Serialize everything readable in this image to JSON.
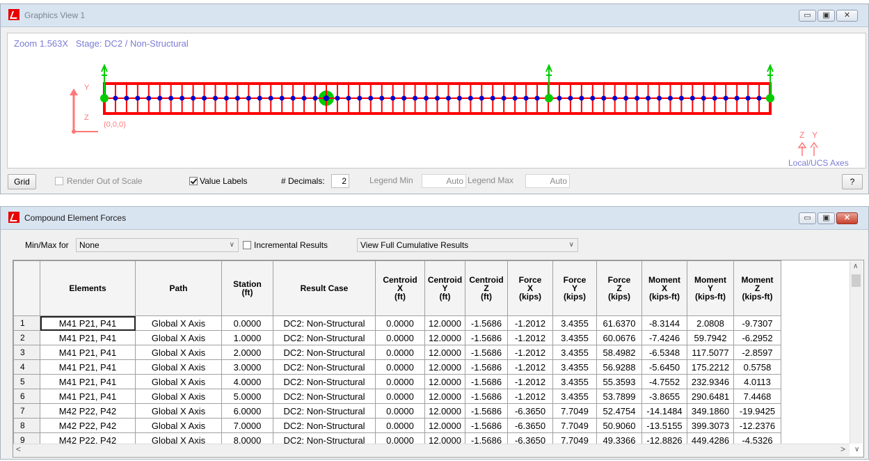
{
  "graphics": {
    "title": "Graphics View 1",
    "zoom_label": "Zoom",
    "zoom_value": "1.563X",
    "stage_label": "Stage:",
    "stage_value": "DC2 / Non-Structural",
    "axis_y": "Y",
    "axis_z": "Z",
    "origin_label": "(0,0,0)",
    "local_axes_label": "Local/UCS Axes",
    "local_z": "Z",
    "local_y": "Y",
    "toolbar": {
      "grid_label": "Grid",
      "render_out_of_scale_label": "Render Out of Scale",
      "render_out_of_scale_checked": false,
      "value_labels_label": "Value Labels",
      "value_labels_checked": true,
      "decimals_label": "# Decimals:",
      "decimals_value": "2",
      "legend_min_label": "Legend Min",
      "legend_min_value": "Auto",
      "legend_max_label": "Legend Max",
      "legend_max_value": "Auto",
      "help_label": "?"
    },
    "colors": {
      "element": "#ff0000",
      "node": "#0000cc",
      "support": "#00cc00",
      "axes": "#ff8888"
    }
  },
  "forces": {
    "title": "Compound Element Forces",
    "minmax_label": "Min/Max for",
    "minmax_value": "None",
    "incremental_label": "Incremental Results",
    "incremental_checked": false,
    "view_value": "View Full Cumulative Results",
    "columns": [
      {
        "lines": [
          "Elements"
        ]
      },
      {
        "lines": [
          "Path"
        ]
      },
      {
        "lines": [
          "Station",
          "(ft)"
        ]
      },
      {
        "lines": [
          "Result Case"
        ]
      },
      {
        "lines": [
          "Centroid",
          "X",
          "(ft)"
        ]
      },
      {
        "lines": [
          "Centroid",
          "Y",
          "(ft)"
        ]
      },
      {
        "lines": [
          "Centroid",
          "Z",
          "(ft)"
        ]
      },
      {
        "lines": [
          "Force",
          "X",
          "(kips)"
        ]
      },
      {
        "lines": [
          "Force",
          "Y",
          "(kips)"
        ]
      },
      {
        "lines": [
          "Force",
          "Z",
          "(kips)"
        ]
      },
      {
        "lines": [
          "Moment",
          "X",
          "(kips-ft)"
        ]
      },
      {
        "lines": [
          "Moment",
          "Y",
          "(kips-ft)"
        ]
      },
      {
        "lines": [
          "Moment",
          "Z",
          "(kips-ft)"
        ]
      }
    ],
    "rows": [
      [
        "1",
        "M41  P21, P41",
        "Global X Axis",
        "0.0000",
        "DC2: Non-Structural",
        "0.0000",
        "12.0000",
        "-1.5686",
        "-1.2012",
        "3.4355",
        "61.6370",
        "-8.3144",
        "2.0808",
        "-9.7307"
      ],
      [
        "2",
        "M41  P21, P41",
        "Global X Axis",
        "1.0000",
        "DC2: Non-Structural",
        "0.0000",
        "12.0000",
        "-1.5686",
        "-1.2012",
        "3.4355",
        "60.0676",
        "-7.4246",
        "59.7942",
        "-6.2952"
      ],
      [
        "3",
        "M41  P21, P41",
        "Global X Axis",
        "2.0000",
        "DC2: Non-Structural",
        "0.0000",
        "12.0000",
        "-1.5686",
        "-1.2012",
        "3.4355",
        "58.4982",
        "-6.5348",
        "117.5077",
        "-2.8597"
      ],
      [
        "4",
        "M41  P21, P41",
        "Global X Axis",
        "3.0000",
        "DC2: Non-Structural",
        "0.0000",
        "12.0000",
        "-1.5686",
        "-1.2012",
        "3.4355",
        "56.9288",
        "-5.6450",
        "175.2212",
        "0.5758"
      ],
      [
        "5",
        "M41  P21, P41",
        "Global X Axis",
        "4.0000",
        "DC2: Non-Structural",
        "0.0000",
        "12.0000",
        "-1.5686",
        "-1.2012",
        "3.4355",
        "55.3593",
        "-4.7552",
        "232.9346",
        "4.0113"
      ],
      [
        "6",
        "M41  P21, P41",
        "Global X Axis",
        "5.0000",
        "DC2: Non-Structural",
        "0.0000",
        "12.0000",
        "-1.5686",
        "-1.2012",
        "3.4355",
        "53.7899",
        "-3.8655",
        "290.6481",
        "7.4468"
      ],
      [
        "7",
        "M42  P22, P42",
        "Global X Axis",
        "6.0000",
        "DC2: Non-Structural",
        "0.0000",
        "12.0000",
        "-1.5686",
        "-6.3650",
        "7.7049",
        "52.4754",
        "-14.1484",
        "349.1860",
        "-19.9425"
      ],
      [
        "8",
        "M42  P22, P42",
        "Global X Axis",
        "7.0000",
        "DC2: Non-Structural",
        "0.0000",
        "12.0000",
        "-1.5686",
        "-6.3650",
        "7.7049",
        "50.9060",
        "-13.5155",
        "399.3073",
        "-12.2376"
      ],
      [
        "9",
        "M42  P22, P42",
        "Global X Axis",
        "8.0000",
        "DC2: Non-Structural",
        "0.0000",
        "12.0000",
        "-1.5686",
        "-6.3650",
        "7.7049",
        "49.3366",
        "-12.8826",
        "449.4286",
        "-4.5326"
      ]
    ]
  }
}
